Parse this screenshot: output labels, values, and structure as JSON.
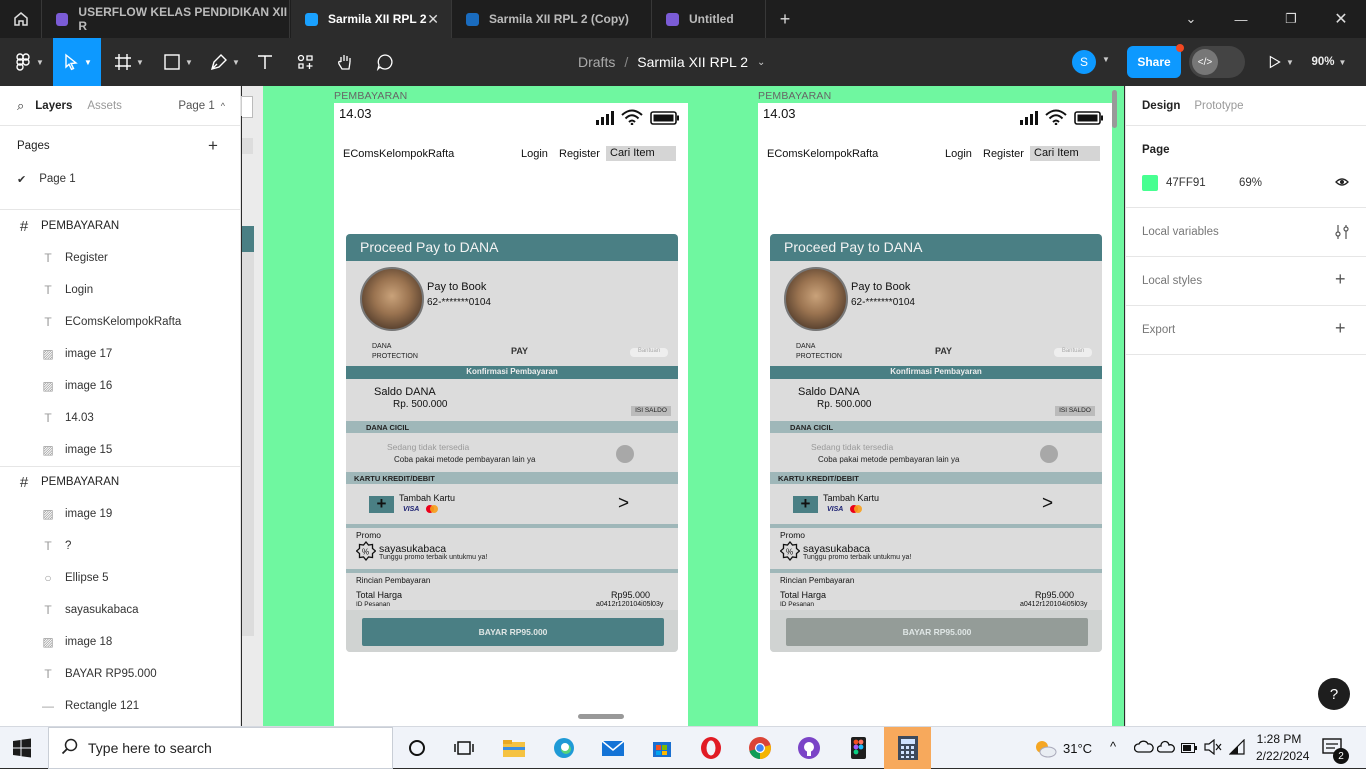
{
  "tabs": [
    {
      "label": "USERFLOW KELAS PENDIDIKAN XII R",
      "color": "#7b5cd6",
      "active": false
    },
    {
      "label": "Sarmila XII RPL 2",
      "color": "#1aa1ff",
      "active": true
    },
    {
      "label": "Sarmila XII RPL 2 (Copy)",
      "color": "#1a6cbf",
      "active": false
    },
    {
      "label": "Untitled",
      "color": "#7b5cd6",
      "active": false
    }
  ],
  "toolbar": {
    "breadcrumb_root": "Drafts",
    "breadcrumb_sep": "/",
    "file_name": "Sarmila XII RPL 2",
    "avatar_initial": "S",
    "share_label": "Share",
    "zoom": "90%",
    "accent": "#0d99ff"
  },
  "left_panel": {
    "tab_layers": "Layers",
    "tab_assets": "Assets",
    "page_selector": "Page 1",
    "pages_title": "Pages",
    "pages": [
      "Page 1"
    ],
    "layers": [
      {
        "name": "PEMBAYARAN",
        "type": "frame",
        "indent": 0
      },
      {
        "name": "Register",
        "type": "text",
        "indent": 1
      },
      {
        "name": "Login",
        "type": "text",
        "indent": 1
      },
      {
        "name": "EComsKelompokRafta",
        "type": "text",
        "indent": 1
      },
      {
        "name": "image 17",
        "type": "image",
        "indent": 1
      },
      {
        "name": "image 16",
        "type": "image",
        "indent": 1
      },
      {
        "name": "14.03",
        "type": "text",
        "indent": 1
      },
      {
        "name": "image 15",
        "type": "image",
        "indent": 1
      },
      {
        "name": "PEMBAYARAN",
        "type": "frame",
        "indent": 0
      },
      {
        "name": "image 19",
        "type": "image",
        "indent": 1
      },
      {
        "name": "?",
        "type": "text",
        "indent": 1
      },
      {
        "name": "Ellipse 5",
        "type": "ellipse",
        "indent": 1
      },
      {
        "name": "sayasukabaca",
        "type": "text",
        "indent": 1
      },
      {
        "name": "image 18",
        "type": "image",
        "indent": 1
      },
      {
        "name": "BAYAR RP95.000",
        "type": "text",
        "indent": 1
      },
      {
        "name": "Rectangle 121",
        "type": "line",
        "indent": 1
      }
    ]
  },
  "canvas": {
    "frame_bg": "#6ff7a0",
    "frames": [
      {
        "label": "PEMBAYARAN",
        "pay_button_color": "#4a7f84"
      },
      {
        "label": "PEMBAYARAN",
        "pay_button_color": "#949c98"
      }
    ],
    "phone": {
      "time": "14.03",
      "brand": "EComsKelompokRafta",
      "nav_login": "Login",
      "nav_register": "Register",
      "search_label": "Cari Item",
      "header": "Proceed Pay to DANA",
      "pay_to": "Pay to Book",
      "account": "62-*******0104",
      "dana_protection_1": "DANA",
      "dana_protection_2": "PROTECTION",
      "pay_label": "PAY",
      "help_label": "Bantuan",
      "confirm_bar": "Konfirmasi Pembayaran",
      "saldo_title": "Saldo DANA",
      "saldo_value": "Rp. 500.000",
      "isi_saldo": "ISI SALDO",
      "cicil_bar": "DANA CICIL",
      "cicil_unavailable": "Sedang tidak tersedia",
      "cicil_hint": "Coba  pakai metode pembayaran lain ya",
      "kartu_bar": "KARTU KREDIT/DEBIT",
      "tambah_kartu": "Tambah Kartu",
      "visa": "VISA",
      "arrow": ">",
      "promo_title": "Promo",
      "promo_code": "sayasukabaca",
      "promo_hint": "Tunggu promo terbaik untukmu ya!",
      "rincian_title": "Rincian Pembayaran",
      "total_label": "Total Harga",
      "total_value": "Rp95.000",
      "id_label": "ID Pesanan",
      "id_value": "a0412r120104i05l03y",
      "pay_button": "BAYAR RP95.000",
      "teal": "#4a7f84"
    }
  },
  "right_panel": {
    "tab_design": "Design",
    "tab_prototype": "Prototype",
    "page_title": "Page",
    "page_color_hex": "47FF91",
    "page_color": "#47ff91",
    "page_opacity": "69%",
    "local_variables": "Local variables",
    "local_styles": "Local styles",
    "export": "Export",
    "help": "?"
  },
  "taskbar": {
    "search_placeholder": "Type here to search",
    "temperature": "31°C",
    "time": "1:28 PM",
    "date": "2/22/2024",
    "notifications": "2"
  }
}
